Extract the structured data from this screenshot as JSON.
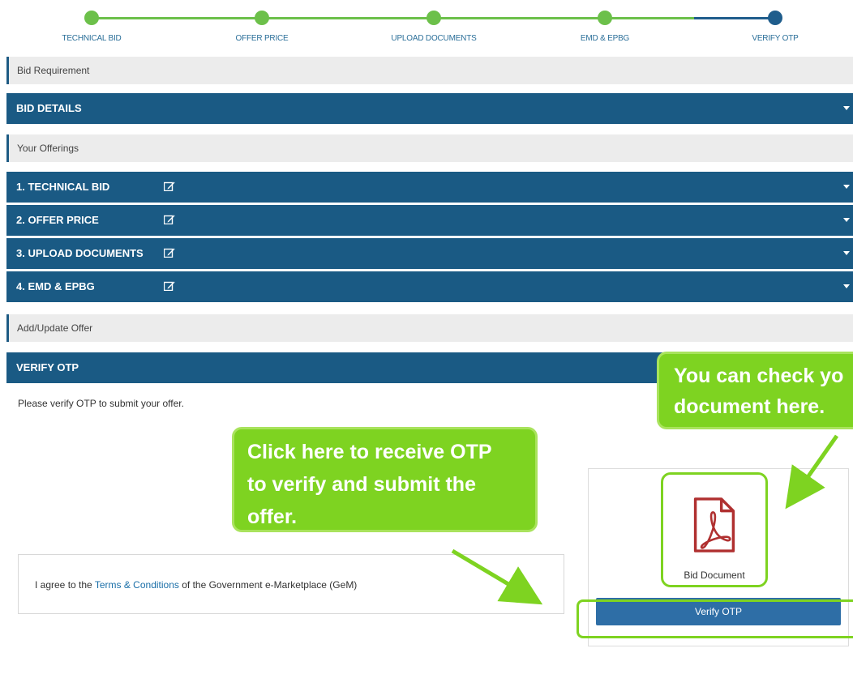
{
  "stepper": {
    "steps": [
      {
        "label": "TECHNICAL BID",
        "state": "done"
      },
      {
        "label": "OFFER PRICE",
        "state": "done"
      },
      {
        "label": "UPLOAD DOCUMENTS",
        "state": "done"
      },
      {
        "label": "EMD & EPBG",
        "state": "done"
      },
      {
        "label": "VERIFY OTP",
        "state": "active"
      }
    ],
    "colors": {
      "done": "#6cc04a",
      "active": "#1f5d8c",
      "inactive_line": "#1f5d8c"
    }
  },
  "sections": {
    "bid_requirement": "Bid Requirement",
    "bid_details": "BID DETAILS",
    "your_offerings": "Your Offerings",
    "offerings": [
      {
        "label": "1. TECHNICAL BID",
        "icon": "edit-icon"
      },
      {
        "label": "2. OFFER PRICE",
        "icon": "edit-icon"
      },
      {
        "label": "3. UPLOAD DOCUMENTS",
        "icon": "edit-icon"
      },
      {
        "label": "4. EMD & EPBG",
        "icon": "edit-icon"
      }
    ],
    "add_update_offer": "Add/Update Offer",
    "verify_otp": "VERIFY OTP"
  },
  "verify": {
    "instruction": "Please verify OTP to submit your offer.",
    "terms_prefix": "I agree to the ",
    "terms_link": "Terms & Conditions",
    "terms_suffix": " of the Government e-Marketplace (GeM)",
    "document_label": "Bid Document",
    "document_icon": "pdf-icon",
    "button_label": "Verify OTP"
  },
  "callouts": {
    "otp": [
      "Click here to receive OTP",
      "to verify and submit the",
      "offer."
    ],
    "document": [
      "You can check yo",
      "document here."
    ]
  },
  "colors": {
    "primary": "#1a5a84",
    "button": "#2e6ea6",
    "highlight": "#7ed321",
    "pdf": "#b03030"
  }
}
